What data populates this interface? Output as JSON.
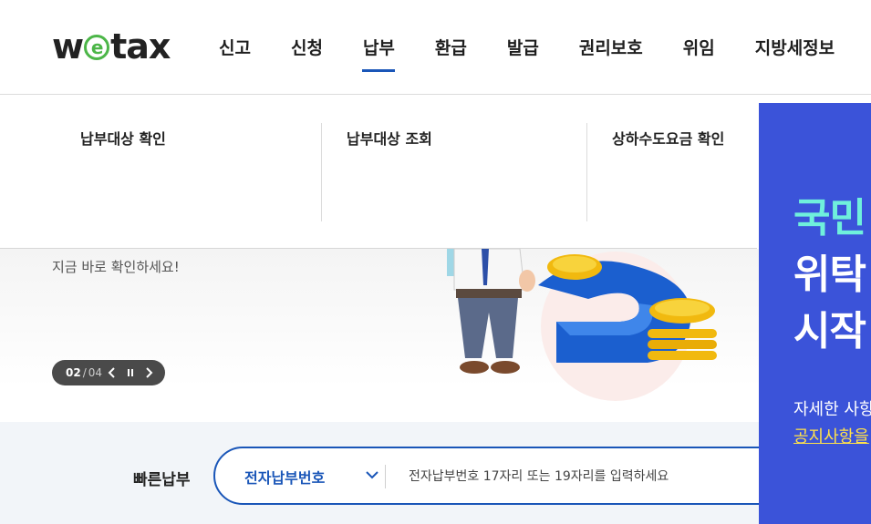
{
  "header": {
    "logo_text_pre": "w",
    "logo_text_e": "e",
    "logo_text_post": "tax",
    "nav": [
      {
        "label": "신고"
      },
      {
        "label": "신청"
      },
      {
        "label": "납부",
        "active": true
      },
      {
        "label": "환급"
      },
      {
        "label": "발급"
      },
      {
        "label": "권리보호"
      },
      {
        "label": "위임"
      },
      {
        "label": "지방세정보"
      }
    ]
  },
  "submenu": {
    "items": [
      {
        "label": "납부대상 확인"
      },
      {
        "label": "납부대상 조회"
      },
      {
        "label": "상하수도요금 확인"
      }
    ]
  },
  "hero": {
    "subtitle": "지금 바로 확인하세요!",
    "pager": {
      "current": "02",
      "separator": "/",
      "total": "04"
    }
  },
  "quick_pay": {
    "title": "빠른납부",
    "select_value": "전자납부번호",
    "input_placeholder": "전자납부번호 17자리 또는 19자리를 입력하세요"
  },
  "popup": {
    "line1": "국민",
    "line2": "위탁",
    "line3": "시작",
    "line4": "자세한 사항",
    "line5": "공지사항을"
  },
  "colors": {
    "accent": "#1a56b8",
    "logo_green": "#4cb648",
    "popup_bg": "#3b53d9",
    "popup_highlight": "#6ff0dc",
    "popup_link": "#ffe14a"
  }
}
